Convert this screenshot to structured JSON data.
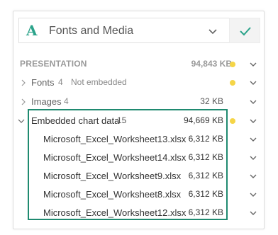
{
  "header": {
    "title": "Fonts and Media",
    "logo_letter": "A",
    "logo_icon": "font-a-icon",
    "dropdown_icon": "chevron-down-icon",
    "confirm_icon": "checkmark-icon"
  },
  "presentation": {
    "label": "PRESENTATION",
    "size": "94,843 KB"
  },
  "fonts_row": {
    "label": "Fonts",
    "count": "4",
    "status": "Not embedded"
  },
  "images_row": {
    "label": "Images",
    "count": "4",
    "size": "32 KB"
  },
  "chart_row": {
    "label": "Embedded chart data",
    "count": "15",
    "size": "94,669 KB"
  },
  "files": [
    {
      "name": "Microsoft_Excel_Worksheet13.xlsx",
      "size": "6,312 KB"
    },
    {
      "name": "Microsoft_Excel_Worksheet14.xlsx",
      "size": "6,312 KB"
    },
    {
      "name": "Microsoft_Excel_Worksheet9.xlsx",
      "size": "6,312 KB"
    },
    {
      "name": "Microsoft_Excel_Worksheet8.xlsx",
      "size": "6,312 KB"
    },
    {
      "name": "Microsoft_Excel_Worksheet12.xlsx",
      "size": "6,312 KB"
    }
  ],
  "colors": {
    "accent": "#2ba38a",
    "highlight_border": "#1f8a70",
    "warning_dot": "#f5d547"
  }
}
